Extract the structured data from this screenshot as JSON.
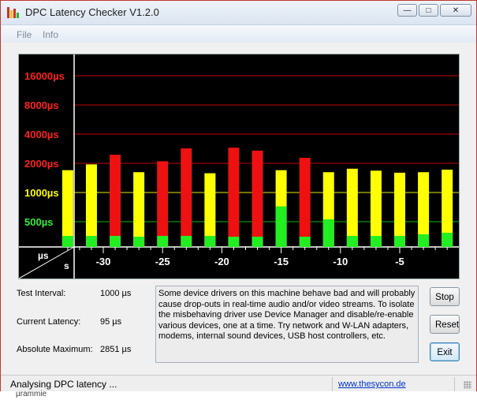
{
  "window": {
    "title": "DPC Latency Checker V1.2.0",
    "controls": {
      "minimize": "—",
      "maximize": "□",
      "close": "✕"
    }
  },
  "menu": {
    "items": [
      "File",
      "Info"
    ]
  },
  "chart_data": {
    "type": "bar",
    "y_scale": "logarithmic (labelled bands)",
    "y_unit": "µs",
    "y_ticks": [
      {
        "label": "16000µs",
        "value": 16000,
        "color": "#ff2020"
      },
      {
        "label": "8000µs",
        "value": 8000,
        "color": "#ff2020"
      },
      {
        "label": "4000µs",
        "value": 4000,
        "color": "#ff2020"
      },
      {
        "label": "2000µs",
        "value": 2000,
        "color": "#ff2020"
      },
      {
        "label": "1000µs",
        "value": 1000,
        "color": "#ffff00"
      },
      {
        "label": "500µs",
        "value": 500,
        "color": "#33ee33"
      }
    ],
    "x_ticks": [
      "-30",
      "-25",
      "-20",
      "-15",
      "-10",
      "-5"
    ],
    "x_tick_seconds": [
      -30,
      -25,
      -20,
      -15,
      -10,
      -5
    ],
    "corner_labels": {
      "y": "µs",
      "x": "s"
    },
    "colors": {
      "green": "#22ee22",
      "yellow": "#ffff00",
      "red": "#ee1111",
      "grid_red": "#c00000",
      "grid_yellow": "#e6e600",
      "grid_green": "#00b400"
    },
    "bars": [
      {
        "t": -33,
        "max": 1700,
        "current": 95
      },
      {
        "t": -31,
        "max": 1950,
        "current": 95
      },
      {
        "t": -29,
        "max": 2450,
        "current": 95
      },
      {
        "t": -27,
        "max": 1620,
        "current": 80
      },
      {
        "t": -25,
        "max": 2100,
        "current": 90
      },
      {
        "t": -23,
        "max": 2851,
        "current": 100
      },
      {
        "t": -21,
        "max": 1580,
        "current": 95
      },
      {
        "t": -19,
        "max": 2900,
        "current": 80
      },
      {
        "t": -17,
        "max": 2700,
        "current": 85
      },
      {
        "t": -15,
        "max": 1700,
        "current": 720
      },
      {
        "t": -13,
        "max": 2280,
        "current": 75
      },
      {
        "t": -11,
        "max": 1620,
        "current": 420
      },
      {
        "t": -9,
        "max": 1760,
        "current": 95
      },
      {
        "t": -7,
        "max": 1680,
        "current": 95
      },
      {
        "t": -5,
        "max": 1600,
        "current": 90
      },
      {
        "t": -3,
        "max": 1620,
        "current": 130
      },
      {
        "t": -1,
        "max": 1720,
        "current": 150
      }
    ]
  },
  "info": {
    "test_interval": {
      "label": "Test Interval:",
      "value": "1000 µs"
    },
    "current_latency": {
      "label": "Current Latency:",
      "value": "95 µs"
    },
    "absolute_maximum": {
      "label": "Absolute Maximum:",
      "value": "2851 µs"
    }
  },
  "description": "Some device drivers on this machine behave bad and will probably cause drop-outs in real-time audio and/or video streams. To isolate the misbehaving driver use Device Manager and disable/re-enable various devices, one at a time. Try network and W-LAN adapters, modems, internal sound devices, USB host controllers, etc.",
  "buttons": {
    "stop": "Stop",
    "reset": "Reset",
    "exit": "Exit"
  },
  "status": {
    "text": "Analysing DPC latency ...",
    "link": "www.thesycon.de"
  },
  "under_text": "µrammie"
}
